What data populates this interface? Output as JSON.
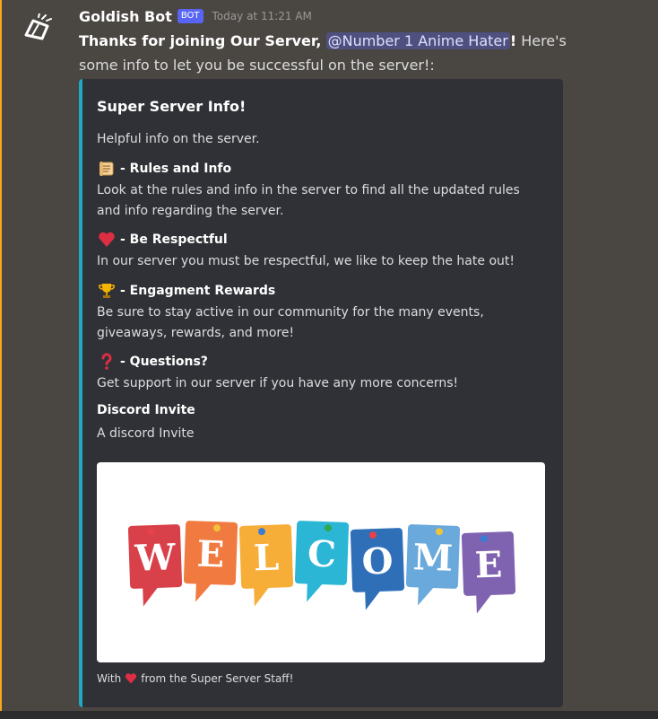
{
  "author": {
    "name": "Goldish Bot",
    "tag": "BOT",
    "timestamp": "Today at 11:21 AM",
    "avatar_icon": "goldish-logo-icon"
  },
  "message": {
    "bold_prefix": "Thanks for joining Our Server,",
    "mention": "@Number 1 Anime Hater",
    "bold_suffix": "!",
    "text_after": "Here's some info to let you be successful on the server!:"
  },
  "embed": {
    "accent_color": "#1fa8c5",
    "title": "Super Server Info!",
    "description": "Helpful info on the server.",
    "fields": [
      {
        "icon": "scroll-icon",
        "name": "- Rules and Info",
        "value": "Look at the rules and info in the server to find all the updated rules and info regarding the server."
      },
      {
        "icon": "heart-icon",
        "name": "- Be Respectful",
        "value": "In our server you must be respectful, we like to keep the hate out!"
      },
      {
        "icon": "trophy-icon",
        "name": "- Engagment Rewards",
        "value": "Be sure to stay active in our community for the many events, giveaways, rewards, and more!"
      },
      {
        "icon": "question-mark-icon",
        "name": "- Questions?",
        "value": "Get support in our server if you have any more concerns!"
      },
      {
        "icon": "",
        "name": "Discord Invite",
        "value": "A discord Invite"
      }
    ],
    "image": {
      "letters": [
        "W",
        "E",
        "L",
        "C",
        "O",
        "M",
        "E"
      ],
      "colors": [
        "#d9414a",
        "#f07a3f",
        "#f6ae38",
        "#2cb6d6",
        "#2f6fb8",
        "#6aa9db",
        "#7f62b0"
      ]
    },
    "footer": {
      "text_before": "With",
      "icon": "heart-icon",
      "text_after": "from the Super Server Staff!"
    }
  }
}
